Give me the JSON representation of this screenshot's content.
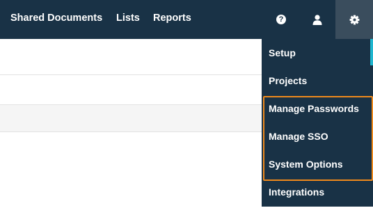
{
  "nav": {
    "links": [
      "Shared Documents",
      "Lists",
      "Reports"
    ],
    "icons": {
      "help": "help-circle-icon",
      "user": "user-icon",
      "settings": "gear-icon"
    },
    "help_glyph": "?"
  },
  "settings_menu": {
    "items": [
      "Setup",
      "Projects",
      "Manage Passwords",
      "Manage SSO",
      "System Options",
      "Integrations"
    ],
    "highlighted": [
      "Manage Passwords",
      "Manage SSO",
      "System Options"
    ]
  },
  "colors": {
    "nav_background": "#193246",
    "active_icon_background": "#3a4d5d",
    "accent": "#1fb6cf",
    "highlight_border": "#f08a1c"
  }
}
